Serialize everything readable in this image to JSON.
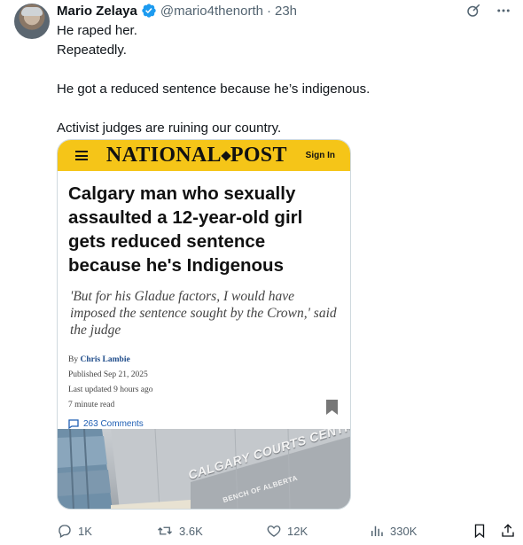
{
  "author": {
    "name": "Mario Zelaya",
    "handle": "@mario4thenorth",
    "separator": "·",
    "time": "23h",
    "verified": true
  },
  "top_icons": [
    "grok-icon",
    "more-icon"
  ],
  "tweet": {
    "lines": [
      "He raped her.",
      "Repeatedly.",
      "",
      "He got a reduced sentence because he’s indigenous.",
      "",
      "Activist judges are ruining our country."
    ]
  },
  "card": {
    "site_name": [
      "NATIONAL",
      "POST"
    ],
    "sign_in": "Sign In",
    "headline": "Calgary man who sexually assaulted a 12-year-old girl gets reduced sentence because he's Indigenous",
    "deck": "'But for his Gladue factors, I would have imposed the sentence sought by the Crown,' said the judge",
    "byline_prefix": "By",
    "author": "Chris Lambie",
    "published": "Published Sep 21, 2025",
    "updated": "Last updated 9 hours ago",
    "read_time": "7 minute read",
    "comments": "263 Comments",
    "photo_sign": "CALGARY COURTS CENTRE",
    "photo_subsign": "BENCH OF ALBERTA",
    "colors": {
      "bar": "#f5c518",
      "link": "#1f5fb4"
    }
  },
  "actions": {
    "replies": "1K",
    "reposts": "3.6K",
    "likes": "12K",
    "views": "330K"
  }
}
